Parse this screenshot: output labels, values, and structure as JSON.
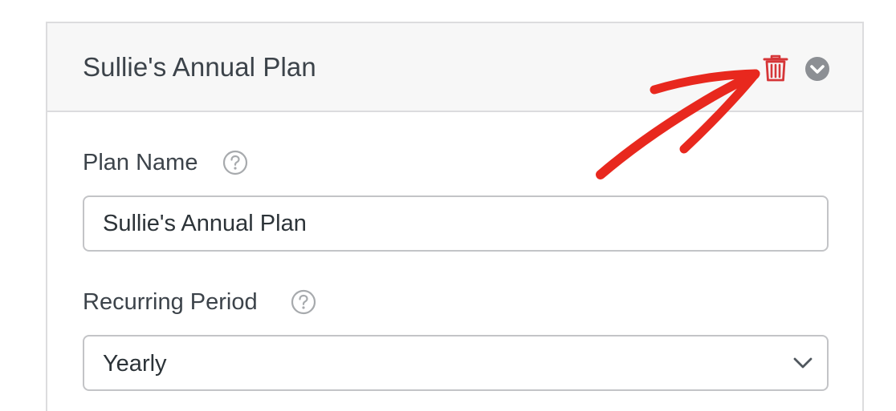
{
  "plan": {
    "title": "Sullie's Annual Plan",
    "plan_name_label": "Plan Name",
    "plan_name_value": "Sullie's Annual Plan",
    "recurring_period_label": "Recurring Period",
    "recurring_period_value": "Yearly"
  },
  "icons": {
    "delete": "trash-icon",
    "toggle": "chevron-down-circle-icon",
    "help": "question-mark-icon",
    "select_arrow": "chevron-down-icon"
  },
  "colors": {
    "delete_icon": "#d63638",
    "annotation_arrow": "#e8281e",
    "header_background": "#f7f7f7",
    "toggle_icon": "#8c8f94"
  }
}
